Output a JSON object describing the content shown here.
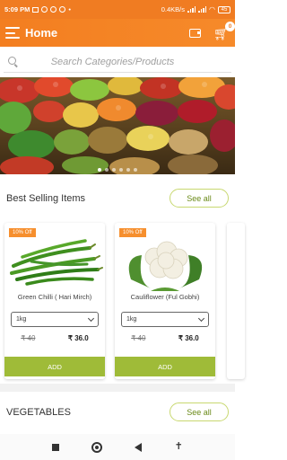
{
  "status_bar": {
    "time": "5:09 PM",
    "network_speed": "0.4KB/s",
    "battery": "45"
  },
  "app_bar": {
    "title": "Home",
    "cart_count": "0"
  },
  "search": {
    "placeholder": "Search Categories/Products"
  },
  "banner": {
    "slide_count": 6,
    "active_slide": 0
  },
  "best_selling": {
    "title": "Best Selling Items",
    "see_all_label": "See all",
    "products": [
      {
        "discount": "10% Off",
        "name": "Green Chilli ( Hari Mirch)",
        "quantity": "1kg",
        "old_price": "₹ 40",
        "new_price": "₹ 36.0",
        "add_label": "ADD"
      },
      {
        "discount": "10% Off",
        "name": "Cauliflower (Ful Gobhi)",
        "quantity": "1kg",
        "old_price": "₹ 40",
        "new_price": "₹ 36.0",
        "add_label": "ADD"
      }
    ]
  },
  "vegetables": {
    "title": "VEGETABLES",
    "see_all_label": "See all"
  },
  "colors": {
    "brand_orange": "#f07c22",
    "add_green": "#9fbb38",
    "badge_orange": "#f68f2e"
  }
}
